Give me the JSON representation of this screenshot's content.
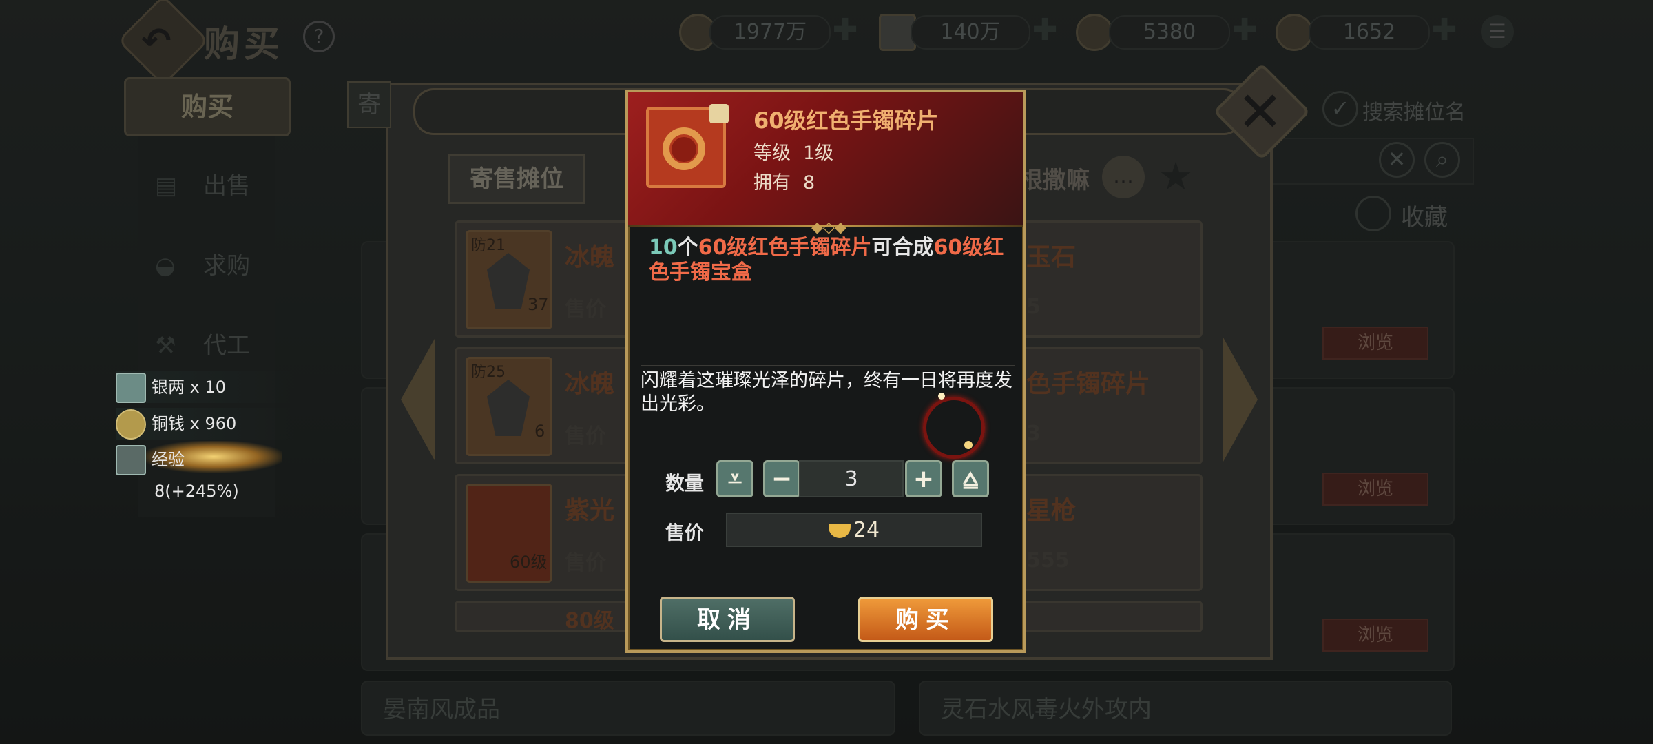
{
  "header": {
    "back_icon": "back-arrow-icon",
    "title": "购买",
    "help_label": "?",
    "currencies": [
      {
        "icon": "copper-coin-icon",
        "value": "1977万"
      },
      {
        "icon": "silver-bar-icon",
        "value": "140万"
      },
      {
        "icon": "gold-ingot-icon",
        "value": "5380"
      },
      {
        "icon": "gold-ingot-icon",
        "value": "1652"
      }
    ],
    "add_label": "✚",
    "menu_icon": "list-menu-icon"
  },
  "sidebar": {
    "buy_tab": "购买",
    "items": [
      {
        "label": "出售",
        "icon": "stall-icon"
      },
      {
        "label": "求购",
        "icon": "bowl-icon"
      },
      {
        "label": "代工",
        "icon": "anvil-icon"
      }
    ]
  },
  "market": {
    "tab_label_partial": "寄",
    "filter_partial": "名",
    "search_stall_label": "搜索摊位名",
    "favorite_label": "收藏",
    "browse_label": "浏览",
    "bottom_cards": [
      "晏南风成品",
      "灵石水风毒火外攻内"
    ]
  },
  "stall": {
    "tab_label": "寄售摊位",
    "owner_partial": "根撒嘛",
    "items": [
      {
        "tag": "防21",
        "count": "37",
        "name": "冰魄",
        "price_label": "售价",
        "right_name": "玉石",
        "right_value": "5"
      },
      {
        "tag": "防25",
        "count": "6",
        "name": "冰魄",
        "price_label": "售价",
        "right_name": "色手镯碎片",
        "right_value": "3"
      },
      {
        "tag": "",
        "count": "60级",
        "name": "紫光",
        "price_label": "售价",
        "right_name": "星枪",
        "right_value": "555"
      },
      {
        "tag": "",
        "count": "",
        "name": "80级",
        "price_label": "",
        "right_name": "",
        "right_value": ""
      }
    ]
  },
  "rewards": [
    {
      "icon": "silver-bar-icon",
      "text": "银两 x 10"
    },
    {
      "icon": "copper-coin-icon",
      "text": "铜钱 x 960"
    },
    {
      "icon": "exp-icon",
      "text": "经验",
      "bonus": "8(+245%)"
    }
  ],
  "popup": {
    "item_icon": "red-bracelet-fragment-icon",
    "title": "60级红色手镯碎片",
    "level_label": "等级",
    "level_value": "1级",
    "owned_label": "拥有",
    "owned_value": "8",
    "compose_count": "10",
    "compose_unit": "个",
    "compose_item": "60级红色手镯碎片",
    "compose_verb": "可合成",
    "compose_result": "60级红色手镯宝盒",
    "description": "闪耀着这璀璨光泽的碎片，终有一日将再度发出光彩。",
    "quantity_label": "数量",
    "quantity_value": "3",
    "min_label": "⩡",
    "minus_label": "−",
    "plus_label": "+",
    "max_label": "⩠",
    "price_label": "售价",
    "price_value": "24",
    "cancel_label": "取消",
    "buy_label": "购买"
  }
}
